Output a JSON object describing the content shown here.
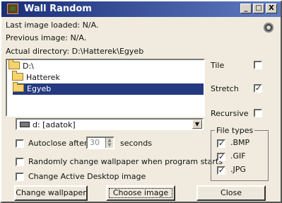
{
  "window": {
    "title": "Wall Random",
    "icon": "wallpaper-icon",
    "controls": {
      "minimize": "_",
      "maximize": "□",
      "close": "X"
    }
  },
  "status": {
    "last_image": "Last image loaded:  N/A.",
    "previous_image": "Previous image:  N/A.",
    "directory": "Actual directory: D:\\Hatterek\\Egyeb"
  },
  "tree": [
    {
      "label": "D:\\"
    },
    {
      "label": "Hatterek"
    },
    {
      "label": "Egyeb"
    }
  ],
  "drive": {
    "label": "d: [adatok]"
  },
  "options": {
    "tile": "Tile",
    "stretch": "Stretch",
    "recursive": "Recursive"
  },
  "checkboxes": {
    "autoclose_prefix": "Autoclose after",
    "autoclose_value": "30",
    "autoclose_suffix": "seconds",
    "random_change": "Randomly change wallpaper when program starts",
    "active_desktop": "Change Active Desktop image"
  },
  "file_types": {
    "title": "File types",
    "items": [
      ".BMP",
      ".GIF",
      ".JPG"
    ]
  },
  "buttons": {
    "change_wallpaper": "Change wallpaper",
    "choose_image": "Choose image",
    "close": "Close"
  },
  "colors": {
    "title_bar": "#1a2d78",
    "selection": "#243a80",
    "window": "#f0ebde"
  }
}
